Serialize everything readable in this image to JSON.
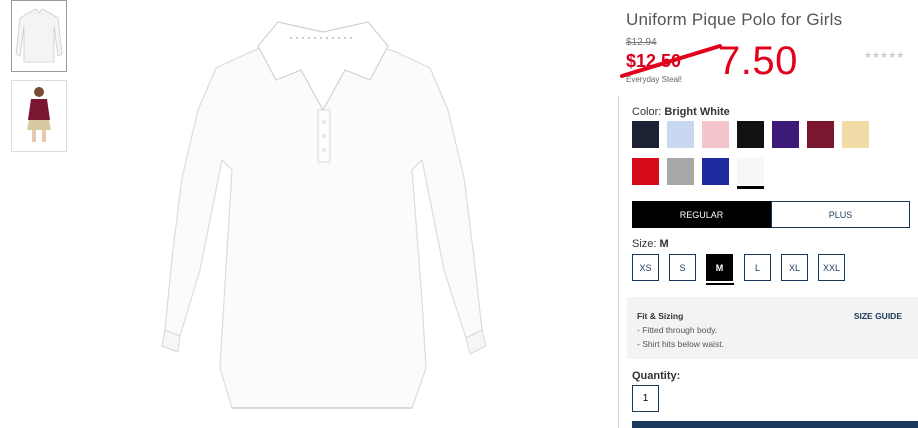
{
  "product": {
    "title": "Uniform Pique Polo for Girls",
    "original_price": "$12.94",
    "sale_price": "$12.50",
    "annotated_price": "7.50",
    "tagline": "Everyday Steal!",
    "stars": "★★★★★"
  },
  "thumbnails": [
    {
      "icon": "white-polo-thumbnail"
    },
    {
      "icon": "model-wearing-uniform-thumbnail"
    }
  ],
  "color": {
    "label": "Color:",
    "selected": "Bright White",
    "swatches": [
      "#1c2233",
      "#c8d8f0",
      "#f2c4cc",
      "#111111",
      "#3d1a78",
      "#7a1630",
      "#f1dca8",
      "#d60a1a",
      "#a8a8a8",
      "#1f2aa0",
      "#f7f7f7"
    ]
  },
  "fit": {
    "options": [
      "REGULAR",
      "PLUS"
    ],
    "selected": "REGULAR"
  },
  "size": {
    "label": "Size:",
    "selected": "M",
    "options": [
      "XS",
      "S",
      "M",
      "L",
      "XL",
      "XXL"
    ]
  },
  "fit_sizing": {
    "title": "Fit & Sizing",
    "link": "SIZE GUIDE",
    "notes": [
      "- Fitted through body.",
      "- Shirt hits below waist."
    ]
  },
  "quantity": {
    "label": "Quantity:",
    "value": "1"
  }
}
